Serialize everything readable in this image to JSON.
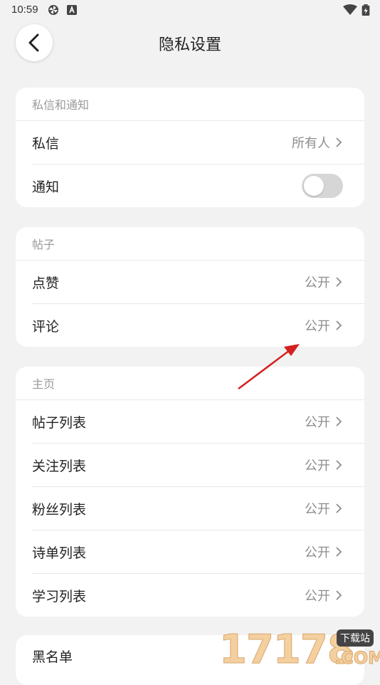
{
  "status_bar": {
    "time": "10:59"
  },
  "header": {
    "title": "隐私设置"
  },
  "sections": [
    {
      "title": "私信和通知",
      "rows": [
        {
          "label": "私信",
          "value": "所有人"
        },
        {
          "label": "通知",
          "toggle_on": false
        }
      ]
    },
    {
      "title": "帖子",
      "rows": [
        {
          "label": "点赞",
          "value": "公开"
        },
        {
          "label": "评论",
          "value": "公开"
        }
      ]
    },
    {
      "title": "主页",
      "rows": [
        {
          "label": "帖子列表",
          "value": "公开"
        },
        {
          "label": "关注列表",
          "value": "公开"
        },
        {
          "label": "粉丝列表",
          "value": "公开"
        },
        {
          "label": "诗单列表",
          "value": "公开"
        },
        {
          "label": "学习列表",
          "value": "公开"
        }
      ]
    }
  ],
  "blacklist": {
    "label": "黑名单"
  },
  "watermark": {
    "brand": "17178",
    "tag": "下载站",
    "domain": ".COM"
  },
  "colors": {
    "background": "#f2f2f2",
    "card": "#ffffff",
    "toggle_off": "#d6d6d6",
    "annotation": "#d42020"
  }
}
